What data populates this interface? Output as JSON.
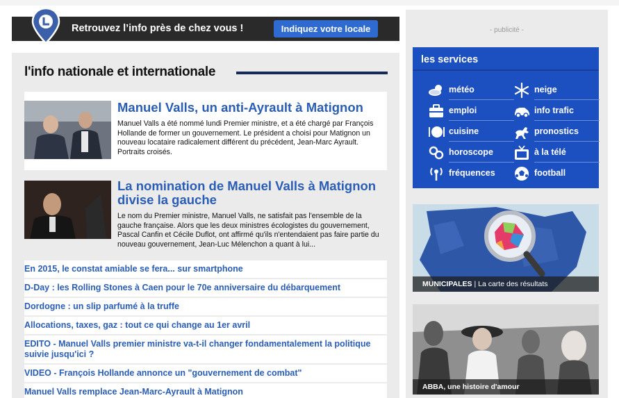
{
  "locale_banner": {
    "text": "Retrouvez l’info près de chez vous !",
    "button_label": "Indiquez votre locale"
  },
  "main": {
    "section_title": "l'info nationale et internationale",
    "articles": [
      {
        "title": "Manuel Valls, un anti-Ayrault à Matignon",
        "body": "Manuel Valls a été nommé lundi Premier ministre, et a été chargé par François Hollande de former un gouvernement. Le président a choisi pour Matignon un nouveau locataire radicalement différent du précédent, Jean-Marc Ayrault. Portraits croisés."
      },
      {
        "title": "La nomination de Manuel Valls à Matignon divise la gauche",
        "body": "Le nom du Premier ministre, Manuel Valls, ne satisfait pas l'ensemble de la gauche française. Alors que les deux ministres écologistes du gouvernement, Pascal Canfin et Cécile Duflot, ont affirmé qu'ils n'entendaient pas faire partie du nouveau gouvernement, Jean-Luc Mélenchon a quant à lui..."
      }
    ],
    "headlines": [
      "En 2015, le constat amiable se fera... sur smartphone",
      "D-Day : les Rolling Stones à Caen pour le 70e anniversaire du débarquement",
      "Dordogne : un slip parfumé à la truffe",
      "Allocations, taxes, gaz : tout ce qui change au 1er avril",
      "EDITO - Manuel Valls premier ministre va-t-il changer fondamentalement la politique suivie jusqu'ici ?",
      "VIDEO - François Hollande annonce un \"gouvernement de combat\"",
      "Manuel Valls remplace Jean-Marc-Ayrault à Matignon"
    ]
  },
  "sidebar": {
    "pub_label": "- publicité -",
    "services_title": "les services",
    "services": [
      {
        "label": "météo",
        "icon": "weather-icon"
      },
      {
        "label": "neige",
        "icon": "snowflake-icon"
      },
      {
        "label": "emploi",
        "icon": "briefcase-icon"
      },
      {
        "label": "info trafic",
        "icon": "car-icon"
      },
      {
        "label": "cuisine",
        "icon": "cooking-icon"
      },
      {
        "label": "pronostics",
        "icon": "horse-icon"
      },
      {
        "label": "horoscope",
        "icon": "zodiac-icon"
      },
      {
        "label": "à la télé",
        "icon": "tv-icon"
      },
      {
        "label": "fréquences",
        "icon": "radio-icon"
      },
      {
        "label": "football",
        "icon": "football-icon"
      }
    ],
    "promos": [
      {
        "caption_strong": "MUNICIPALES",
        "caption_rest": " | La carte des résultats"
      },
      {
        "caption_strong": "ABBA, une histoire d'amour",
        "caption_rest": ""
      }
    ]
  },
  "colors": {
    "accent_blue": "#2a5db5",
    "services_blue": "#1c4fbf",
    "rule_navy": "#152a59",
    "button_blue": "#2f6ad0"
  }
}
